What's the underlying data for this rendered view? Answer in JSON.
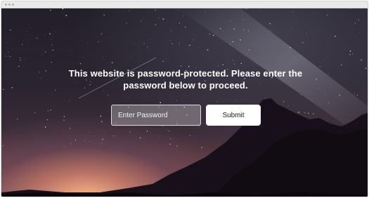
{
  "window": {
    "titlebar_dots": 3
  },
  "background": {
    "image": "starry-night-mountain-landscape",
    "colors": {
      "sky_top": "#231f2a",
      "horizon_glow": "#ffbe8c",
      "mountain": "#150f18"
    }
  },
  "page": {
    "message": "This website is password-protected. Please enter the password below to proceed.",
    "password_input": {
      "value": "",
      "placeholder": "Enter Password"
    },
    "submit_label": "Submit"
  }
}
